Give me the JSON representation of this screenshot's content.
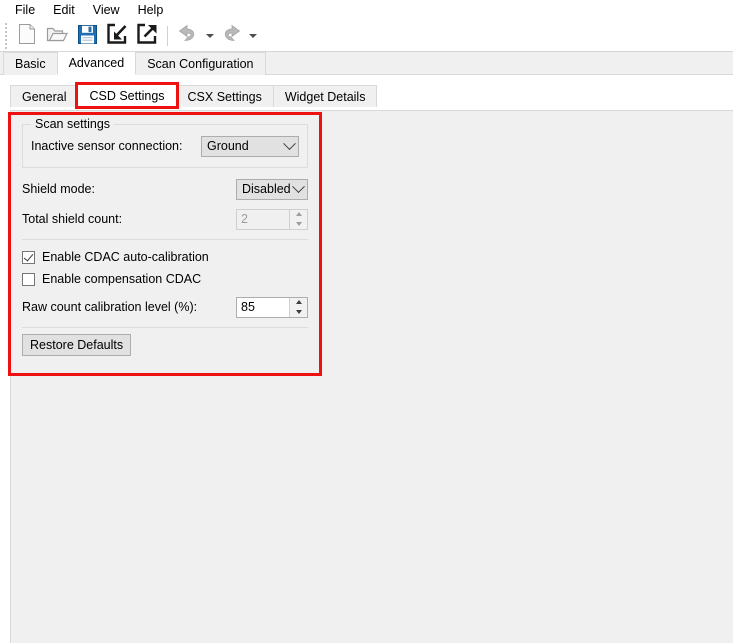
{
  "menubar": {
    "items": [
      {
        "label": "File",
        "name": "menu-file"
      },
      {
        "label": "Edit",
        "name": "menu-edit"
      },
      {
        "label": "View",
        "name": "menu-view"
      },
      {
        "label": "Help",
        "name": "menu-help"
      }
    ]
  },
  "toolbar": {
    "buttons": [
      {
        "icon": "new-file-icon",
        "title": "New"
      },
      {
        "icon": "open-folder-icon",
        "title": "Open"
      },
      {
        "icon": "save-icon",
        "title": "Save"
      },
      {
        "icon": "import-icon",
        "title": "Import"
      },
      {
        "icon": "export-icon",
        "title": "Export"
      },
      {
        "icon": "undo-icon",
        "title": "Undo"
      },
      {
        "icon": "redo-icon",
        "title": "Redo"
      }
    ]
  },
  "outer_tabs": {
    "items": [
      {
        "label": "Basic",
        "active": false
      },
      {
        "label": "Advanced",
        "active": true
      },
      {
        "label": "Scan Configuration",
        "active": false
      }
    ]
  },
  "inner_tabs": {
    "items": [
      {
        "label": "General",
        "active": false,
        "highlight": false
      },
      {
        "label": "CSD Settings",
        "active": true,
        "highlight": true
      },
      {
        "label": "CSX Settings",
        "active": false,
        "highlight": false
      },
      {
        "label": "Widget Details",
        "active": false,
        "highlight": false
      }
    ]
  },
  "csd_settings": {
    "group": {
      "title": "Scan settings",
      "inactive_sensor_connection": {
        "label": "Inactive sensor connection:",
        "value": "Ground"
      }
    },
    "shield_mode": {
      "label": "Shield mode:",
      "value": "Disabled"
    },
    "total_shield_count": {
      "label": "Total shield count:",
      "value": "2",
      "disabled": true
    },
    "enable_cdac_auto_calibration": {
      "label": "Enable CDAC auto-calibration",
      "checked": true
    },
    "enable_compensation_cdac": {
      "label": "Enable compensation CDAC",
      "checked": false
    },
    "raw_count_calibration_level": {
      "label": "Raw count calibration level (%):",
      "value": "85"
    },
    "restore_defaults_label": "Restore Defaults"
  },
  "colors": {
    "highlight_red": "#ee1111",
    "panel_bg": "#f0f0f0",
    "tab_active_bg": "#ffffff",
    "control_bg": "#e1e1e1",
    "save_icon_blue": "#1f6fb5"
  }
}
